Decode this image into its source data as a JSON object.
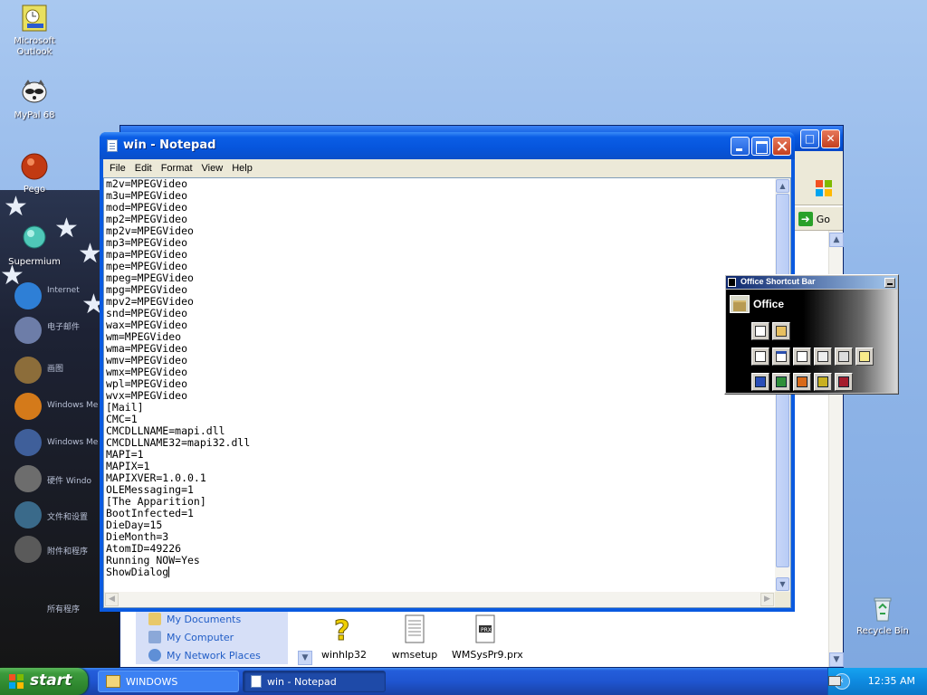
{
  "desktop": {
    "icons": [
      {
        "label": "Microsoft Outlook",
        "icon": "outlook-icon"
      },
      {
        "label": "MyPal 68",
        "icon": "raccoon-icon"
      },
      {
        "label": "Pego",
        "icon": "red-orb-icon"
      },
      {
        "label": "Supermium",
        "icon": "teal-orb-icon"
      },
      {
        "label": "Recycle Bin",
        "icon": "recycle-bin-icon"
      }
    ]
  },
  "explorer": {
    "go_label": "Go",
    "left_links": [
      "My Documents",
      "My Computer",
      "My Network Places"
    ],
    "files": [
      "winhlp32",
      "wmsetup",
      "WMSysPr9.prx"
    ]
  },
  "notepad": {
    "title": "win - Notepad",
    "menu": [
      "File",
      "Edit",
      "Format",
      "View",
      "Help"
    ],
    "lines": [
      "m2v=MPEGVideo",
      "m3u=MPEGVideo",
      "mod=MPEGVideo",
      "mp2=MPEGVideo",
      "mp2v=MPEGVideo",
      "mp3=MPEGVideo",
      "mpa=MPEGVideo",
      "mpe=MPEGVideo",
      "mpeg=MPEGVideo",
      "mpg=MPEGVideo",
      "mpv2=MPEGVideo",
      "snd=MPEGVideo",
      "wax=MPEGVideo",
      "wm=MPEGVideo",
      "wma=MPEGVideo",
      "wmv=MPEGVideo",
      "wmx=MPEGVideo",
      "wpl=MPEGVideo",
      "wvx=MPEGVideo",
      "[Mail]",
      "CMC=1",
      "CMCDLLNAME=mapi.dll",
      "CMCDLLNAME32=mapi32.dll",
      "MAPI=1",
      "MAPIX=1",
      "MAPIXVER=1.0.0.1",
      "OLEMessaging=1",
      "[The Apparition]",
      "BootInfected=1",
      "DieDay=15",
      "DieMonth=3",
      "AtomID=49226",
      "Running NOW=Yes",
      "ShowDialog"
    ]
  },
  "office_bar": {
    "title": "Office Shortcut Bar",
    "folder_label": "Office"
  },
  "wallpaper_menu": [
    "Internet",
    "电子邮件",
    "画图",
    "Windows Me",
    "Windows Me",
    "硬件 Windo",
    "文件和设置",
    "附件和程序",
    "所有程序"
  ],
  "taskbar": {
    "start_label": "start",
    "tasks": [
      {
        "label": "WINDOWS",
        "active": false
      },
      {
        "label": "win - Notepad",
        "active": true
      }
    ],
    "clock": "12:35 AM"
  }
}
